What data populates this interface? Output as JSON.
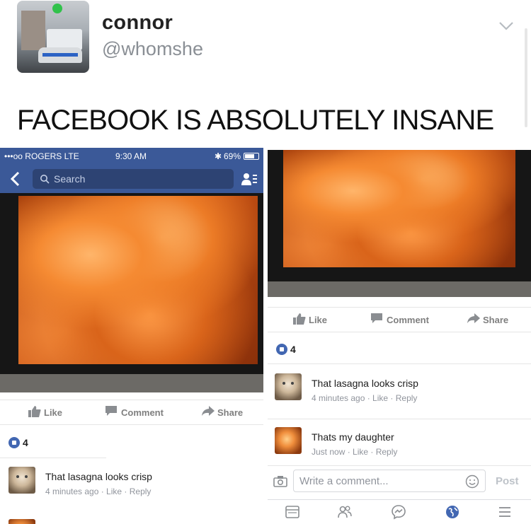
{
  "tweet": {
    "username": "connor",
    "handle": "@whomshe",
    "text": "FACEBOOK IS ABSOLUTELY INSANE",
    "menu_icon": "chevron-down-icon"
  },
  "left_screenshot": {
    "status": {
      "carrier": "•••oo ROGERS  LTE",
      "time": "9:30 AM",
      "battery": "69%"
    },
    "search_placeholder": "Search",
    "actions": {
      "like": "Like",
      "comment": "Comment",
      "share": "Share"
    },
    "like_count": "4",
    "comment": {
      "text": "That lasagna looks crisp",
      "meta": "4 minutes ago · Like · Reply"
    }
  },
  "right_screenshot": {
    "actions": {
      "like": "Like",
      "comment": "Comment",
      "share": "Share"
    },
    "like_count": "4",
    "comments": [
      {
        "text": "That lasagna looks crisp",
        "meta": "4 minutes ago · Like · Reply"
      },
      {
        "text": "Thats my daughter",
        "meta": "Just now · Like · Reply"
      }
    ],
    "composer": {
      "placeholder": "Write a comment...",
      "post_label": "Post"
    },
    "tabs": [
      "news-feed-icon",
      "friends-icon",
      "messenger-icon",
      "globe-icon",
      "menu-icon"
    ]
  },
  "colors": {
    "facebook_blue": "#3b5998",
    "like_blue": "#4267b2",
    "muted": "#90949c"
  }
}
